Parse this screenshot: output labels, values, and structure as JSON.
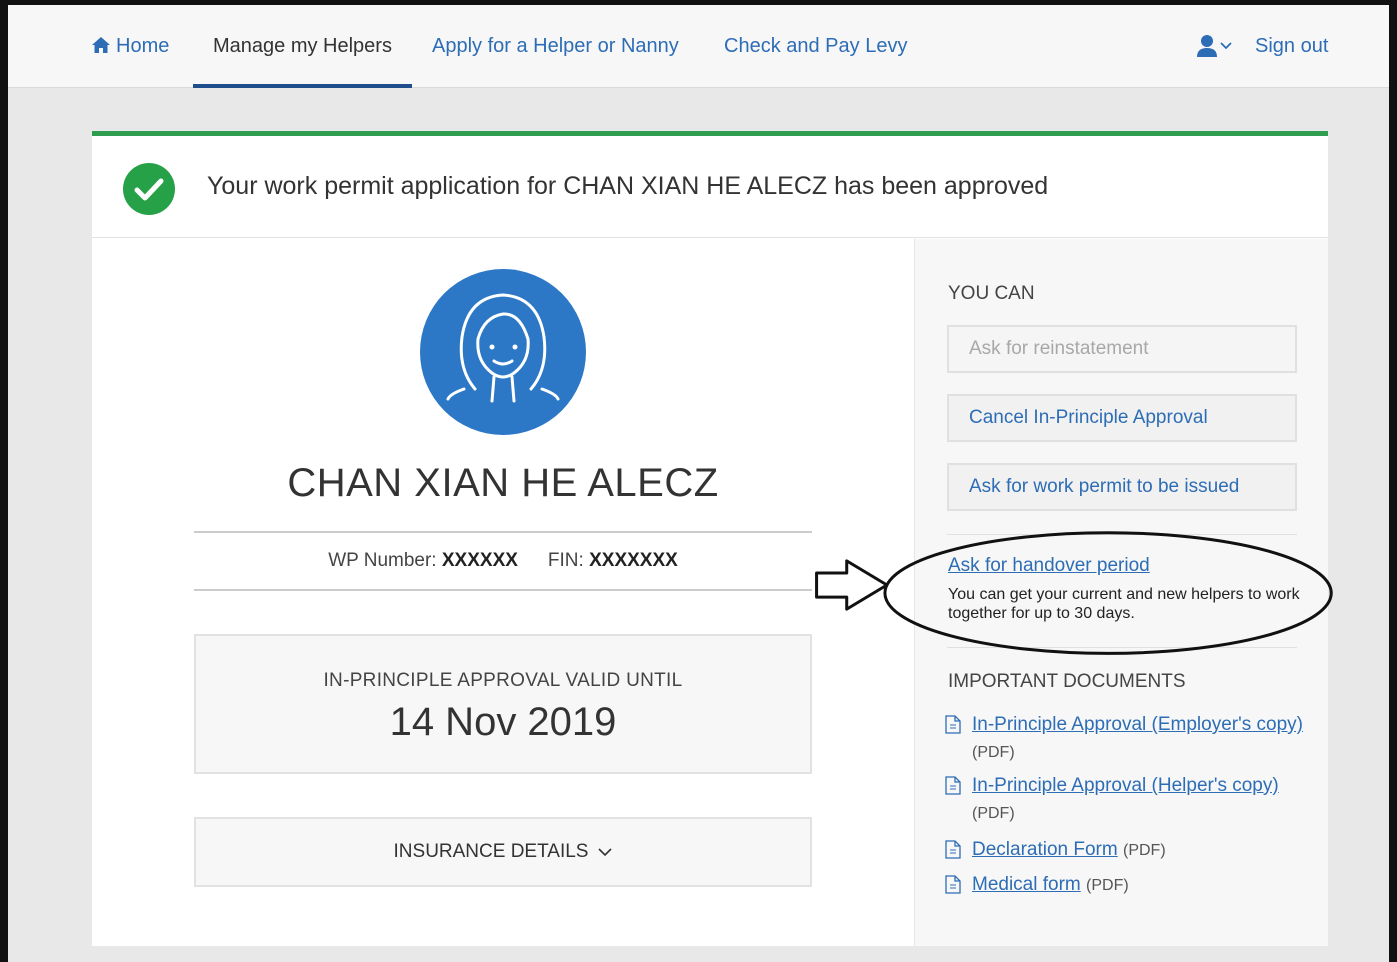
{
  "nav": {
    "home": "Home",
    "manage": "Manage my Helpers",
    "apply": "Apply for a Helper or Nanny",
    "levy": "Check and Pay Levy",
    "signout": "Sign out"
  },
  "banner": {
    "message": "Your work permit application for CHAN XIAN HE ALECZ has been approved"
  },
  "helper": {
    "name": "CHAN XIAN HE ALECZ",
    "wp_label": "WP Number:",
    "wp_value": "XXXXXX",
    "fin_label": "FIN:",
    "fin_value": "XXXXXXX"
  },
  "ipa": {
    "label": "IN-PRINCIPLE APPROVAL VALID UNTIL",
    "date": "14 Nov 2019"
  },
  "insurance": {
    "label": "INSURANCE DETAILS"
  },
  "you_can": {
    "title": "YOU CAN",
    "actions": [
      {
        "label": "Ask for reinstatement",
        "enabled": false
      },
      {
        "label": "Cancel In-Principle Approval",
        "enabled": true
      },
      {
        "label": "Ask for work permit to be issued",
        "enabled": true
      }
    ],
    "handover_link": "Ask for handover period",
    "handover_desc": "You can get your current and new helpers to work together for up to 30 days."
  },
  "documents": {
    "title": "IMPORTANT DOCUMENTS",
    "items": [
      {
        "link": "In-Principle Approval (Employer's copy)",
        "suffix": "(PDF)"
      },
      {
        "link": "In-Principle Approval (Helper's copy)",
        "suffix": "(PDF)"
      },
      {
        "link": "Declaration Form",
        "suffix": "(PDF)"
      },
      {
        "link": "Medical form",
        "suffix": "(PDF)"
      }
    ]
  },
  "colors": {
    "link": "#2d6db5",
    "success": "#27a147",
    "active_tab": "#1f4e8c",
    "avatar": "#2d78c6"
  }
}
